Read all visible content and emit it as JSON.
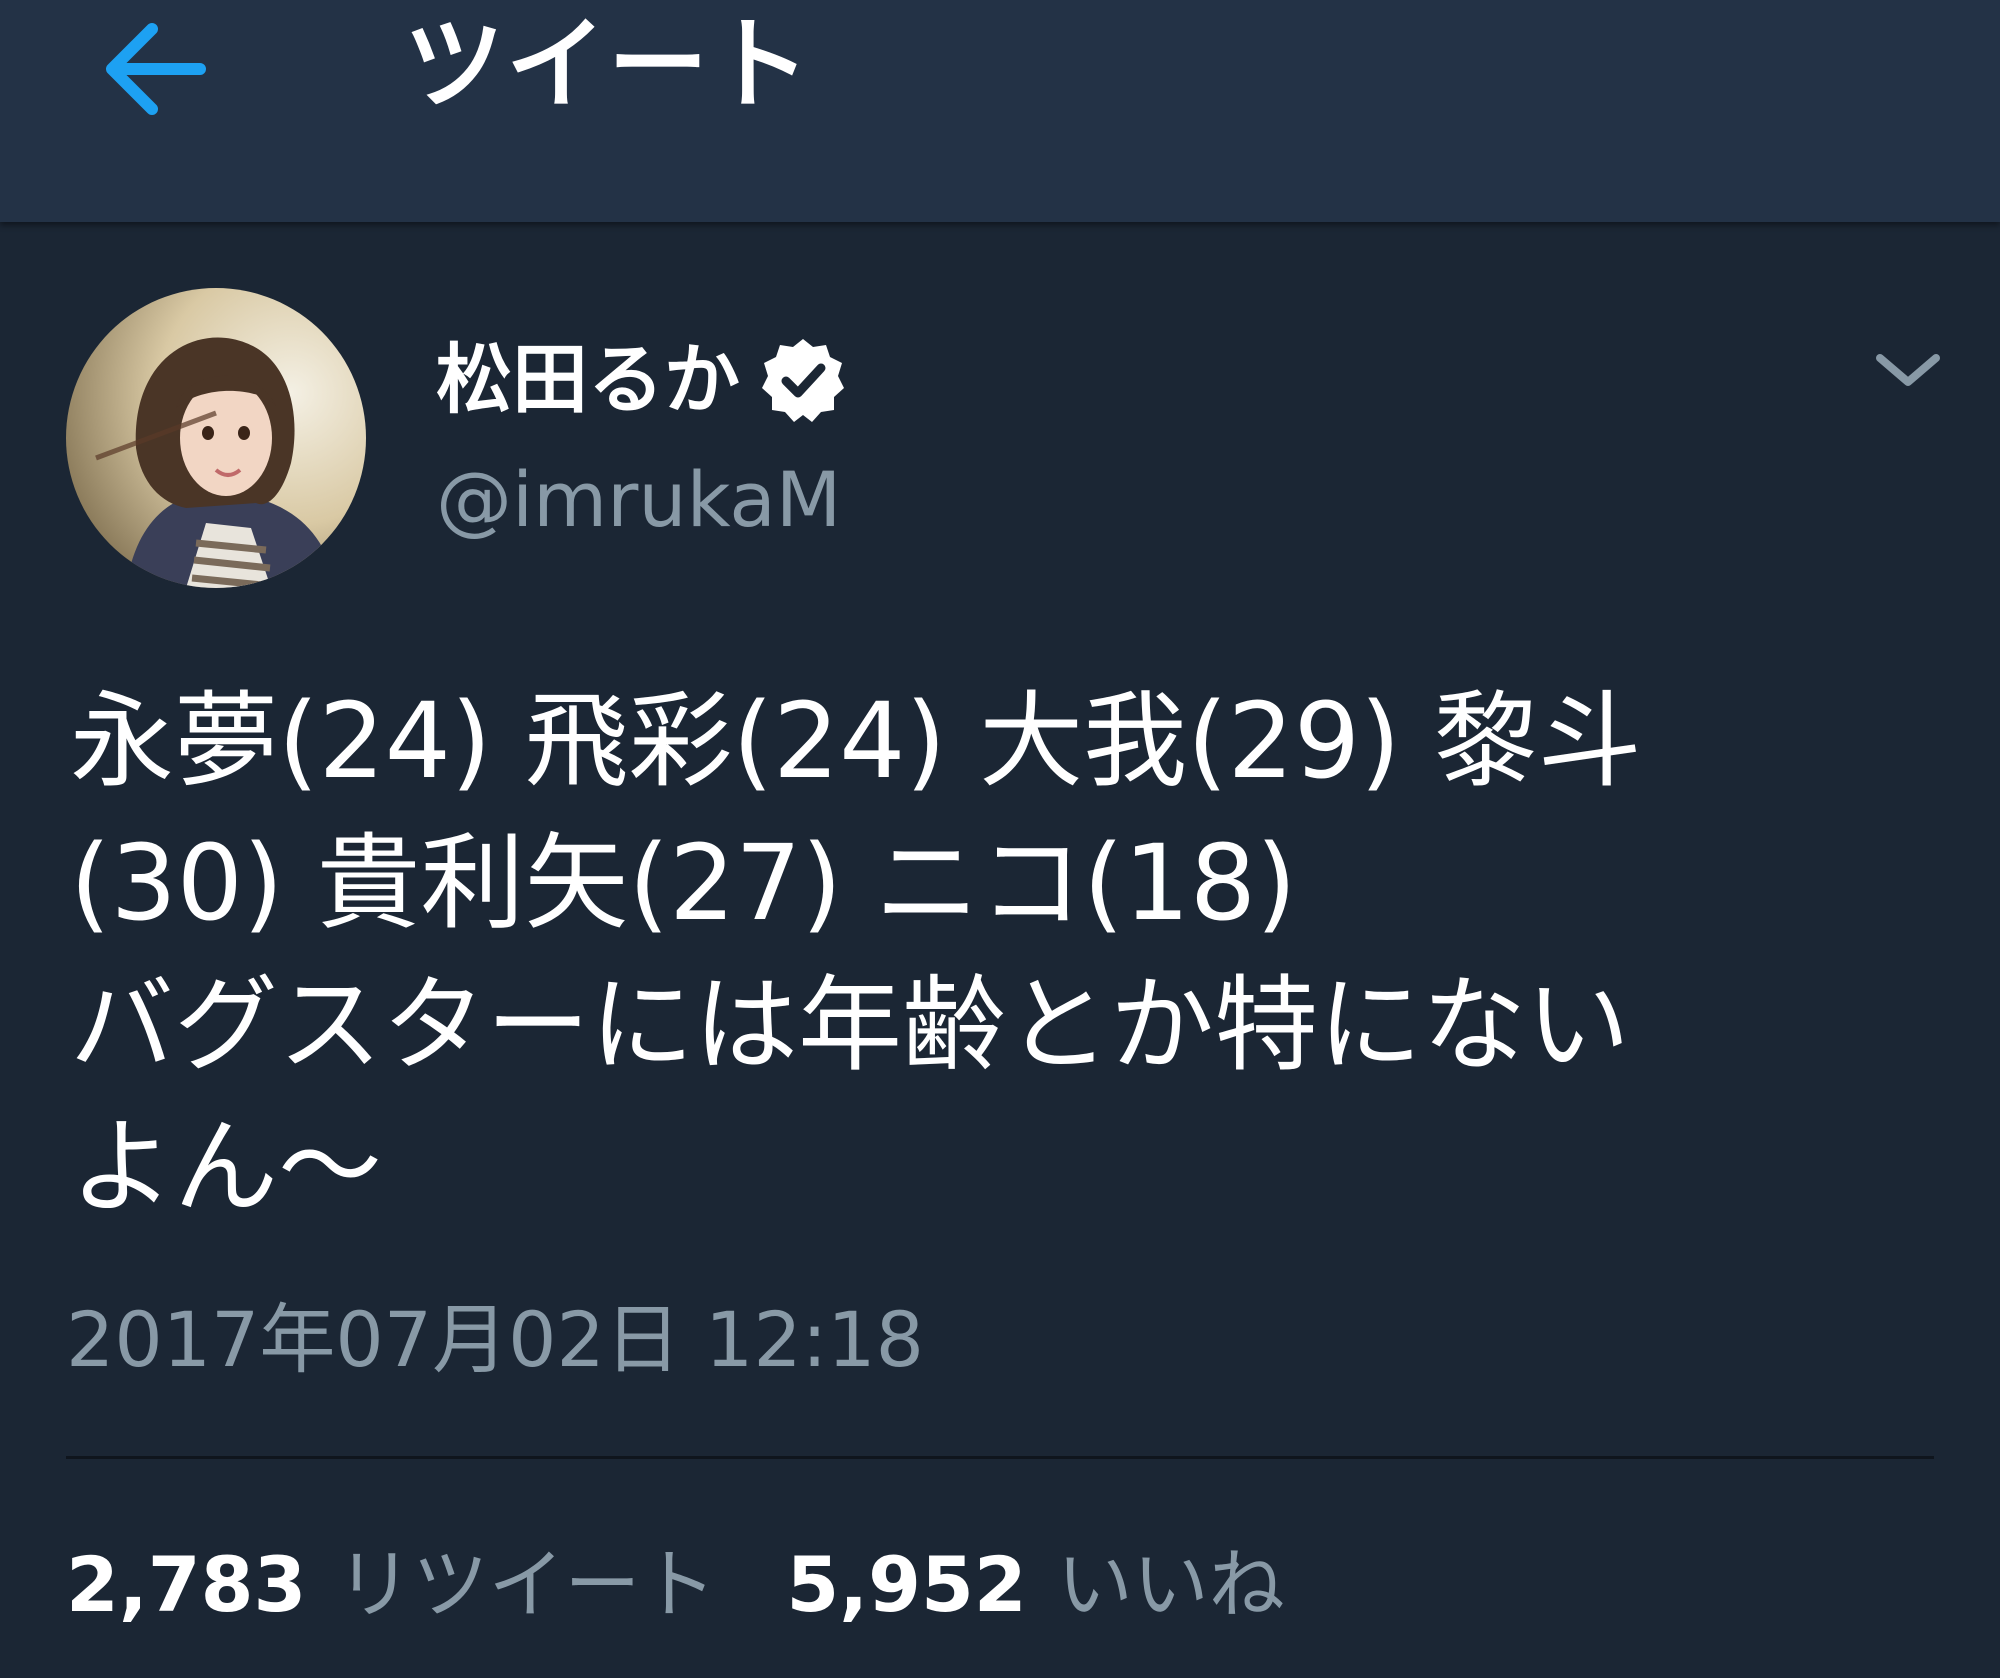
{
  "header": {
    "title": "ツイート",
    "back_icon": "back-arrow-icon",
    "accent_color": "#1da1f2"
  },
  "tweet": {
    "author": {
      "display_name": "松田るか",
      "handle": "@imrukaM",
      "verified": true,
      "verified_icon": "verified-badge-icon",
      "avatar_icon": "avatar-photo"
    },
    "menu_icon": "chevron-down-icon",
    "text": "永夢(24) 飛彩(24) 大我(29) 黎斗\n(30) 貴利矢(27) ニコ(18)\nバグスターには年齢とか特にない\nよん〜",
    "timestamp": "2017年07月02日 12:18",
    "stats": {
      "retweets_count": "2,783",
      "retweets_label": "リツイート",
      "likes_count": "5,952",
      "likes_label": "いいね"
    }
  },
  "colors": {
    "background": "#1b2634",
    "header_background": "#233246",
    "secondary_text": "#8899a6",
    "primary_text": "#ffffff"
  }
}
